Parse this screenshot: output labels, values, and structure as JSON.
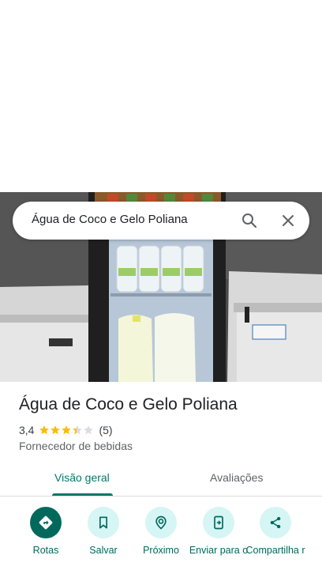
{
  "search": {
    "query": "Água de Coco e Gelo Poliana"
  },
  "place": {
    "name": "Água de Coco e Gelo Poliana",
    "rating": "3,4",
    "stars_value": 3.4,
    "reviews_count": "(5)",
    "category": "Fornecedor de bebidas"
  },
  "tabs": [
    {
      "label": "Visão geral",
      "active": true
    },
    {
      "label": "Avaliações",
      "active": false
    }
  ],
  "actions": [
    {
      "label": "Rotas",
      "icon": "directions-icon"
    },
    {
      "label": "Salvar",
      "icon": "bookmark-icon"
    },
    {
      "label": "Próximo",
      "icon": "nearby-icon"
    },
    {
      "label": "Enviar para o",
      "icon": "send-to-phone-icon"
    },
    {
      "label": "Compartilha r",
      "icon": "share-icon"
    }
  ],
  "colors": {
    "accent": "#00796b",
    "action_primary_bg": "#00695c",
    "action_bg": "#d6f5f5",
    "star": "#fbbc04"
  }
}
